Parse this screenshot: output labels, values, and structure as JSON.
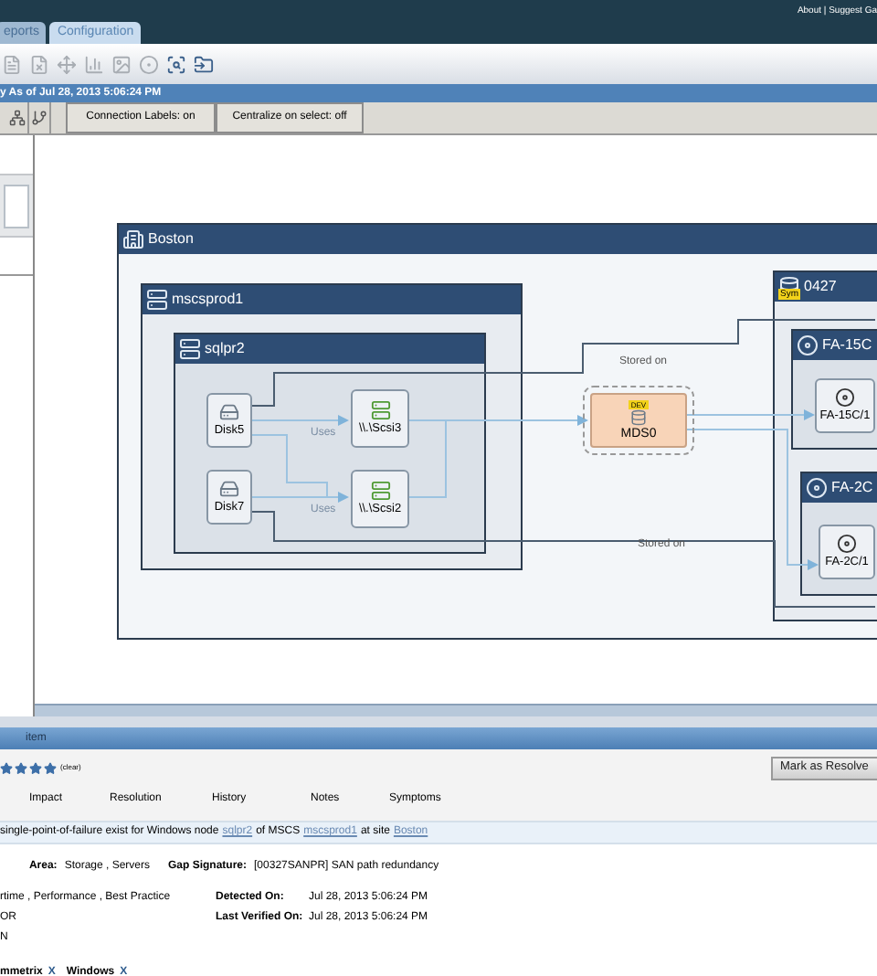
{
  "header": {
    "links": "About | Suggest Ga"
  },
  "tabs": [
    {
      "label": "eports",
      "selected": false
    },
    {
      "label": "Configuration",
      "selected": true
    }
  ],
  "view_bar": {
    "title": "y As of Jul 28, 2013 5:06:24 PM"
  },
  "view_options": [
    {
      "label": "Connection Labels: on"
    },
    {
      "label": "Centralize on select: off"
    }
  ],
  "diagram": {
    "site": {
      "name": "Boston"
    },
    "cluster": {
      "name": "mscsprod1"
    },
    "host": {
      "name": "sqlpr2"
    },
    "disks": [
      {
        "name": "Disk5"
      },
      {
        "name": "Disk7"
      }
    ],
    "ports": [
      {
        "name": "\\\\.\\Scsi3"
      },
      {
        "name": "\\\\.\\Scsi2"
      }
    ],
    "uses_labels": [
      "Uses",
      "Uses"
    ],
    "stored_labels": [
      "Stored on",
      "Stored on"
    ],
    "device": {
      "name": "MDS0",
      "badge": "DEV",
      "selected": true
    },
    "array": {
      "name": "0427",
      "badge": "Sym"
    },
    "directors": [
      {
        "name": "FA-15C",
        "port": "FA-15C/1"
      },
      {
        "name": "FA-2C",
        "port": "FA-2C/1"
      }
    ]
  },
  "detail": {
    "title": "item",
    "stars": 4,
    "clear": "(clear)",
    "action": "Mark as Resolve",
    "tabs": [
      "Impact",
      "Resolution",
      "History",
      "Notes",
      "Symptoms"
    ],
    "summary": [
      {
        "kind": "text",
        "text": "single-point-of-failure exist for Windows node"
      },
      {
        "kind": "link",
        "text": "sqlpr2"
      },
      {
        "kind": "text",
        "text": "of MSCS"
      },
      {
        "kind": "link",
        "text": "mscsprod1"
      },
      {
        "kind": "text",
        "text": "at site"
      },
      {
        "kind": "link",
        "text": "Boston"
      }
    ],
    "area": {
      "label": "Area:",
      "value": "Storage , Servers"
    },
    "gap": {
      "label": "Gap Signature:",
      "value": "[00327SANPR] SAN path redundancy"
    },
    "left_lines": [
      "rtime , Performance , Best Practice",
      "OR",
      "N"
    ],
    "detected": {
      "label": "Detected On:",
      "value": "Jul 28, 2013 5:06:24 PM"
    },
    "verified": {
      "label": "Last Verified On:",
      "value": "Jul 28, 2013 5:06:24 PM"
    },
    "tags": [
      {
        "label": "mmetrix",
        "remove": "X"
      },
      {
        "label": "Windows",
        "remove": "X"
      }
    ]
  }
}
